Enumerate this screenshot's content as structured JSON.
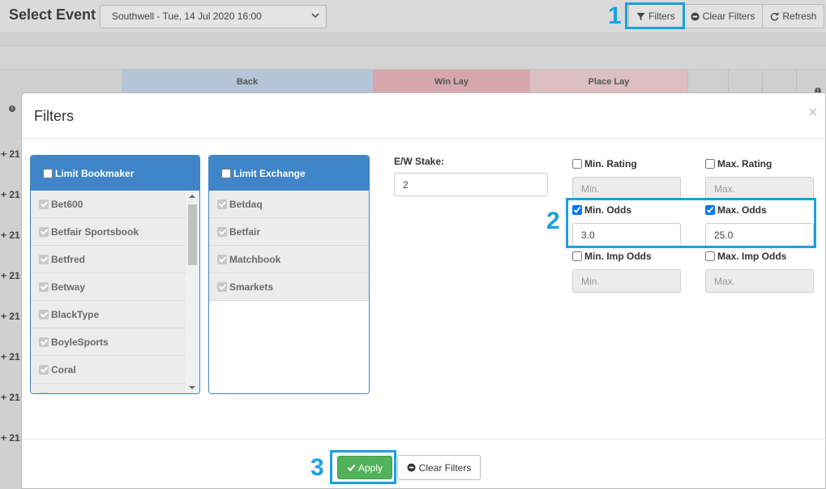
{
  "header": {
    "title": "Select Event",
    "event_selected": "Southwell - Tue, 14 Jul 2020 16:00",
    "buttons": {
      "filters": "Filters",
      "clear_filters": "Clear Filters",
      "refresh": "Refresh"
    }
  },
  "table": {
    "columns": [
      "Back",
      "Win Lay",
      "Place Lay"
    ],
    "row_prefix": "+ 21"
  },
  "annotations": [
    "1",
    "2",
    "3"
  ],
  "modal": {
    "title": "Filters",
    "close": "×",
    "bookmaker": {
      "heading": "Limit Bookmaker",
      "items": [
        "Bet600",
        "Betfair Sportsbook",
        "Betfred",
        "Betway",
        "BlackType",
        "BoyleSports",
        "Coral"
      ]
    },
    "exchange": {
      "heading": "Limit Exchange",
      "items": [
        "Betdaq",
        "Betfair",
        "Matchbook",
        "Smarkets"
      ]
    },
    "ew_stake": {
      "label": "E/W Stake:",
      "value": "2"
    },
    "min_rating": {
      "label": "Min. Rating",
      "placeholder": "Min."
    },
    "max_rating": {
      "label": "Max. Rating",
      "placeholder": "Max."
    },
    "min_odds": {
      "label": "Min. Odds",
      "value": "3.0"
    },
    "max_odds": {
      "label": "Max. Odds",
      "value": "25.0"
    },
    "min_imp_odds": {
      "label": "Min. Imp Odds",
      "placeholder": "Min."
    },
    "max_imp_odds": {
      "label": "Max. Imp Odds",
      "placeholder": "Max."
    },
    "apply_label": "Apply",
    "clear_label": "Clear Filters"
  },
  "colors": {
    "panel_blue": "#3f85c8",
    "apply_green": "#52b25a",
    "annotation_blue": "#1aa1e0"
  }
}
